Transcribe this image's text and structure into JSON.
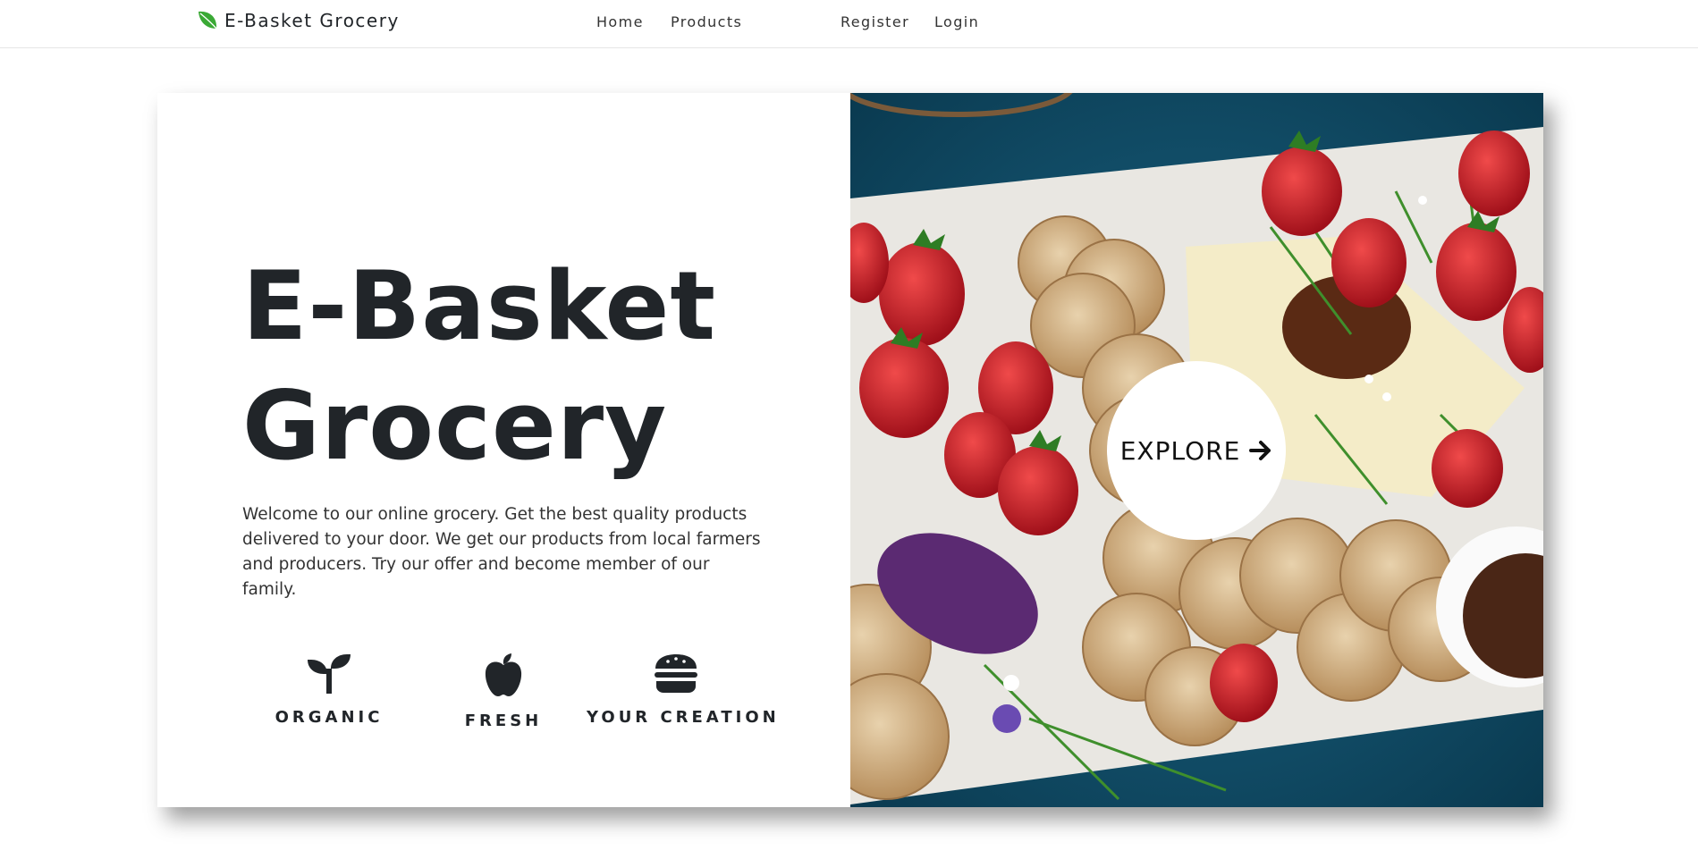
{
  "navbar": {
    "brand": "E-Basket Grocery",
    "links": [
      {
        "label": "Home"
      },
      {
        "label": "Products"
      },
      {
        "label": "Register"
      },
      {
        "label": "Login"
      }
    ]
  },
  "hero": {
    "title": "E-Basket Grocery",
    "description": "Welcome to our online grocery. Get the best quality products delivered to your door. We get our products from local farmers and producers. Try our offer and become member of our family.",
    "features": [
      {
        "label": "ORGANIC",
        "icon": "seedling-icon"
      },
      {
        "label": "FRESH",
        "icon": "apple-icon"
      },
      {
        "label": "YOUR CREATION",
        "icon": "hamburger-icon"
      }
    ],
    "explore_label": "EXPLORE",
    "image": "food-platter-photo"
  },
  "colors": {
    "brand_leaf": "#3aa935",
    "text": "#212529",
    "image_background": "#0f4a63"
  }
}
